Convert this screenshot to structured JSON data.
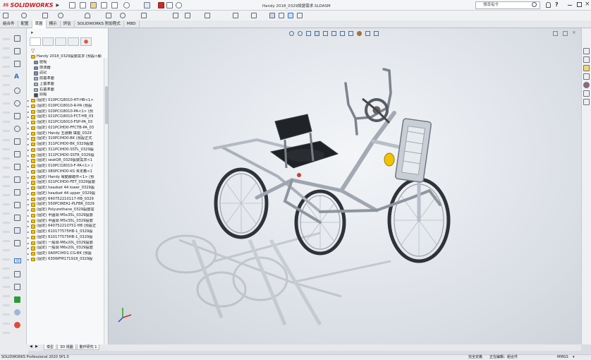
{
  "app": {
    "brand": "SOLIDWORKS",
    "brand_prefix": "3S",
    "document_title": "Handy 2018_0329設變需求.SLDASM",
    "search_placeholder": "搜尋指令",
    "help_label": "?"
  },
  "menu_tabs": [
    "組合件",
    "配置",
    "草圖",
    "標示",
    "評估",
    "SOLIDWORKS 附加程式",
    "MBD"
  ],
  "active_menu_tab": 2,
  "tree": {
    "root": "Handy 2018_0329設變需求 (預設<顯",
    "items": [
      {
        "label": "歷程",
        "kind": "history"
      },
      {
        "label": "感測器",
        "kind": "sensor"
      },
      {
        "label": "註記",
        "kind": "annotation"
      },
      {
        "label": "前基準面",
        "kind": "plane"
      },
      {
        "label": "上基準面",
        "kind": "plane"
      },
      {
        "label": "右基準面",
        "kind": "plane"
      },
      {
        "label": "原點",
        "kind": "origin"
      },
      {
        "label": "(固定) 010PCI18010-HT-HB<1>",
        "kind": "part"
      },
      {
        "label": "(固定) 010PCI18010-R-PA (預設",
        "kind": "part"
      },
      {
        "label": "(固定) 020PCI18010-PA<1> (預",
        "kind": "part"
      },
      {
        "label": "(固定) 021PCI18010-FCT-HB_03",
        "kind": "part"
      },
      {
        "label": "(固定) 021PCI16010-FSP-PA_03",
        "kind": "part"
      },
      {
        "label": "(固定) 021PCIHD0-FFCTB-PA_03",
        "kind": "part"
      },
      {
        "label": "(固定) Handy 五通轉 填座_0329",
        "kind": "part"
      },
      {
        "label": "(固定) 310PCIHD0-BK (預設正式",
        "kind": "part"
      },
      {
        "label": "(固定) 311PCIHD0-BK_0329設變",
        "kind": "part"
      },
      {
        "label": "(固定) 311PCIHD0-SSTL_0329設",
        "kind": "part"
      },
      {
        "label": "(固定) 311PCIHD0-SSTR_0329設",
        "kind": "part"
      },
      {
        "label": "(固定) seatQR_0329設變需求<1",
        "kind": "part"
      },
      {
        "label": "(固定) 010PCI18010-F-PA<1> (",
        "kind": "part"
      },
      {
        "label": "(固定) 080PCIHD0-KS 未定義<1",
        "kind": "part"
      },
      {
        "label": "(固定) Handy 電動腳踏件<1> (預",
        "kind": "part"
      },
      {
        "label": "(固定) 021PCIHD0-FET_0329設變",
        "kind": "part"
      },
      {
        "label": "(固定) headset 44 lower_0329設",
        "kind": "part"
      },
      {
        "label": "(固定) headset 44 upper_0329設",
        "kind": "part"
      },
      {
        "label": "(固定) 640752210117-HB_0329",
        "kind": "part"
      },
      {
        "label": "(固定) 550PCIREA1-PLFBR_0329",
        "kind": "part"
      },
      {
        "label": "(固定) Polyurethane_0329設變需",
        "kind": "part"
      },
      {
        "label": "(固定) 半圓頭 M5x35L_0329設變",
        "kind": "part"
      },
      {
        "label": "(固定) 半圓頭 M5x35L_0329設變",
        "kind": "part"
      },
      {
        "label": "(固定) 640752210751-HB (預設正",
        "kind": "part"
      },
      {
        "label": "(固定) 610177575HB-1_0329設",
        "kind": "part"
      },
      {
        "label": "(固定) 610177575HB-1_0329設",
        "kind": "part"
      },
      {
        "label": "(固定) 一般頭 M6x20L_0329設變",
        "kind": "part"
      },
      {
        "label": "(固定) 一般頭 M6x20L_0329設變",
        "kind": "part"
      },
      {
        "label": "(固定) 0A0PCIHD1-CG-BK (預設",
        "kind": "part"
      },
      {
        "label": "(固定) 630WFM171918_0329設",
        "kind": "part"
      }
    ]
  },
  "bottom_tabs": [
    "模型",
    "3D 視圖",
    "動作研究 1"
  ],
  "active_bottom_tab": 0,
  "status": {
    "product": "SOLIDWORKS Professional 2020 SP1.0",
    "state_1": "完全定義",
    "state_2": "正在編輯：組合件",
    "units": "MMGS",
    "units_caret": "▾"
  },
  "colors": {
    "accent": "#2a6fc9",
    "brand_red": "#d4171c",
    "part_yellow": "#f2c200",
    "viewport_bg": "#e0e4ea"
  }
}
